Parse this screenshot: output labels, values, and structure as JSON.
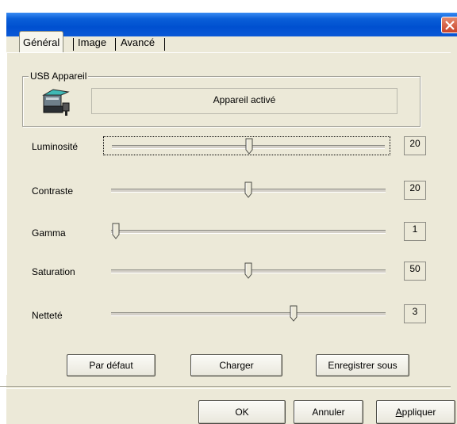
{
  "window": {
    "close_icon": "close-icon"
  },
  "tabs": [
    {
      "label": "Général",
      "active": true
    },
    {
      "label": "Image",
      "active": false
    },
    {
      "label": "Avancé",
      "active": false
    }
  ],
  "device_group": {
    "label": "USB Appareil",
    "icon": "scanner-device-icon",
    "status": "Appareil activé"
  },
  "sliders": [
    {
      "label": "Luminosité",
      "value": "20",
      "position": 0.5,
      "focused": true
    },
    {
      "label": "Contraste",
      "value": "20",
      "position": 0.5,
      "focused": false
    },
    {
      "label": "Gamma",
      "value": "1",
      "position": 0.0,
      "focused": false
    },
    {
      "label": "Saturation",
      "value": "50",
      "position": 0.5,
      "focused": false
    },
    {
      "label": "Netteté",
      "value": "3",
      "position": 0.67,
      "focused": false
    }
  ],
  "panel_buttons": {
    "default": "Par défaut",
    "load": "Charger",
    "save_as": "Enregistrer sous"
  },
  "footer_buttons": {
    "ok": "OK",
    "cancel": "Annuler",
    "apply_first": "A",
    "apply_rest": "ppliquer"
  },
  "colors": {
    "titlebar": "#0a5fd8",
    "close_button": "#c8432a",
    "dialog_background": "#ece9d8"
  }
}
